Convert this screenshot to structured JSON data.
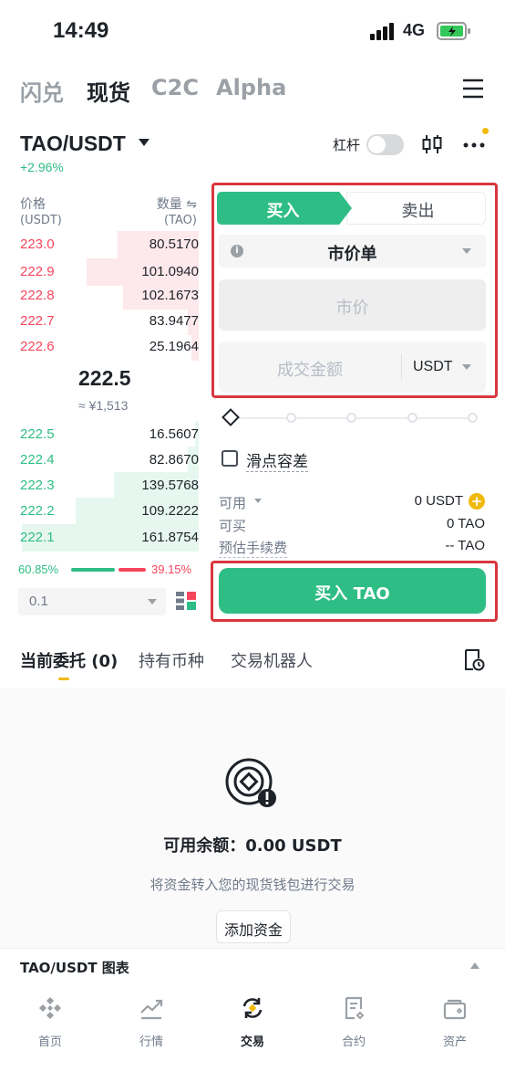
{
  "status_bar": {
    "time": "14:49",
    "network": "4G"
  },
  "top_tabs": [
    "闪兑",
    "现货",
    "C2C",
    "Alpha"
  ],
  "pair": {
    "name": "TAO/USDT",
    "change": "+2.96%",
    "leverage_label": "杠杆"
  },
  "orderbook": {
    "price_header": "价格",
    "price_unit": "(USDT)",
    "qty_header": "数量 ⇋",
    "qty_unit": "(TAO)",
    "asks": [
      {
        "price": "223.0",
        "qty": "80.5170",
        "depth": 0.45
      },
      {
        "price": "222.9",
        "qty": "101.0940",
        "depth": 0.62
      },
      {
        "price": "222.8",
        "qty": "102.1673",
        "depth": 0.42
      },
      {
        "price": "222.7",
        "qty": "83.9477",
        "depth": 0.06
      },
      {
        "price": "222.6",
        "qty": "25.1964",
        "depth": 0.04
      }
    ],
    "mid_price": "222.5",
    "mid_cny": "≈ ¥1,513",
    "bids": [
      {
        "price": "222.5",
        "qty": "16.5607",
        "depth": 0.02
      },
      {
        "price": "222.4",
        "qty": "82.8670",
        "depth": 0.06
      },
      {
        "price": "222.3",
        "qty": "139.5768",
        "depth": 0.47
      },
      {
        "price": "222.2",
        "qty": "109.2222",
        "depth": 0.68
      },
      {
        "price": "222.1",
        "qty": "161.8754",
        "depth": 0.98
      }
    ],
    "buy_ratio": "60.85%",
    "sell_ratio": "39.15%",
    "depth_step": "0.1"
  },
  "order_form": {
    "buy_tab": "买入",
    "sell_tab": "卖出",
    "order_type": "市价单",
    "price_placeholder": "市价",
    "amount_placeholder": "成交金额",
    "amount_unit": "USDT",
    "slippage_label": "滑点容差",
    "available_label": "可用",
    "available_value": "0 USDT",
    "can_buy_label": "可买",
    "can_buy_value": "0 TAO",
    "fee_label": "预估手续费",
    "fee_value": "-- TAO",
    "submit_label": "买入 TAO"
  },
  "orders": {
    "tabs": [
      "当前委托 (0)",
      "持有币种",
      "交易机器人"
    ],
    "balance_text": "可用余额：0.00 USDT",
    "hint_text": "将资金转入您的现货钱包进行交易",
    "add_funds": "添加资金"
  },
  "chart_bar_label": "TAO/USDT 图表",
  "bottom_nav": [
    "首页",
    "行情",
    "交易",
    "合约",
    "资产"
  ],
  "colors": {
    "green": "#2ebd85",
    "red": "#f6465d",
    "yellow": "#f0b90b",
    "highlight": "#d9363e"
  }
}
